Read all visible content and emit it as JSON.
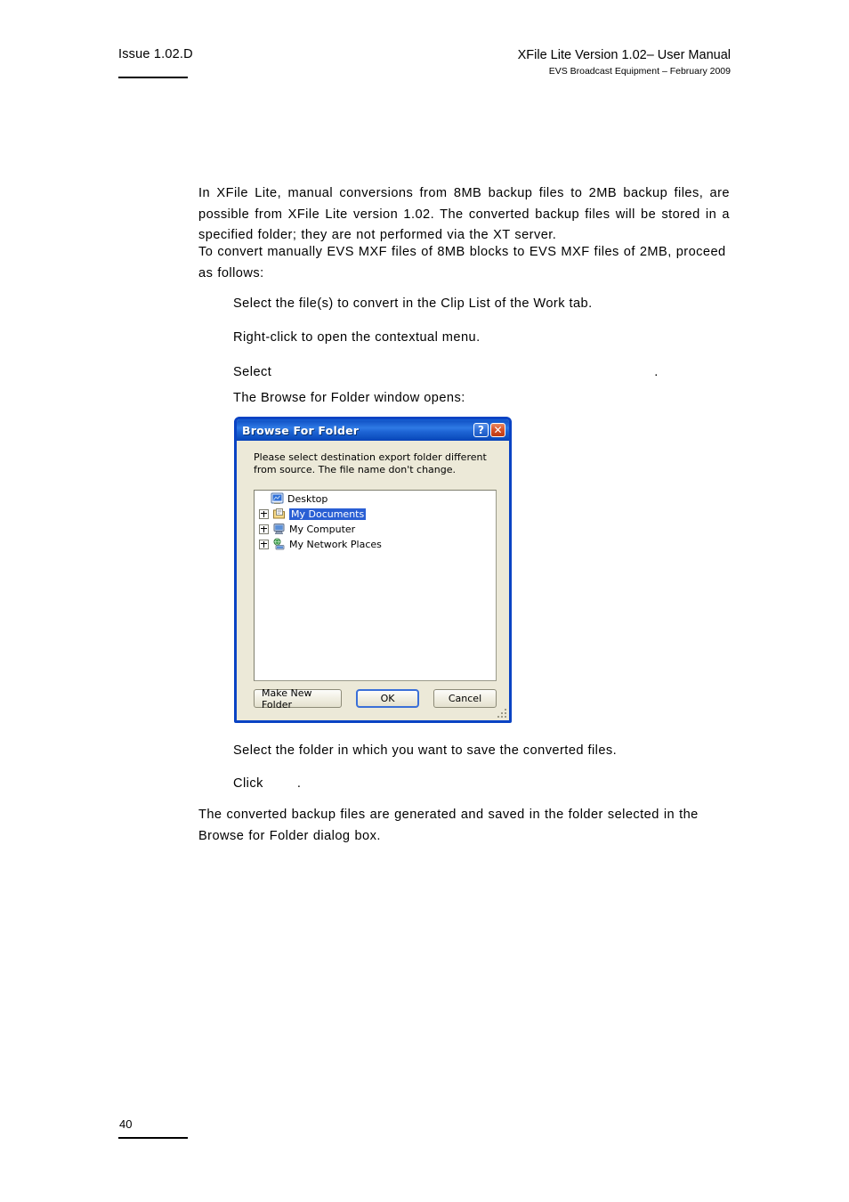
{
  "header": {
    "issue": "Issue 1.02.D",
    "manual_title": "XFile Lite Version 1.02– User Manual",
    "manual_subtitle": "EVS Broadcast Equipment – February 2009"
  },
  "content": {
    "paragraph_1": "In XFile Lite, manual conversions from 8MB backup files to 2MB backup files, are possible from XFile Lite version 1.02. The converted backup files will be stored in a specified folder; they are not performed via the XT server.",
    "paragraph_2": "To convert manually EVS MXF files of 8MB blocks to EVS MXF files of 2MB, proceed as follows:",
    "step_1": "Select the file(s) to convert in the Clip List of the Work tab.",
    "step_2": "Right-click to open the contextual menu.",
    "step_3_prefix": "Select",
    "step_3_suffix": ".",
    "step_4": "The Browse for Folder window opens:",
    "step_5": "Select the folder in which you want to save the converted files.",
    "step_6_prefix": "Click",
    "step_6_suffix": ".",
    "paragraph_3": "The converted backup files are generated and saved in the folder selected in the Browse for Folder dialog box."
  },
  "dialog": {
    "title": "Browse For Folder",
    "help_button": "?",
    "close_button": "✕",
    "instruction": "Please select destination export folder different from source. The file name don't change.",
    "tree": [
      {
        "label": "Desktop",
        "icon": "desktop-icon",
        "level": 0,
        "expandable": false,
        "selected": false
      },
      {
        "label": "My Documents",
        "icon": "my-documents-icon",
        "level": 1,
        "expandable": true,
        "selected": true
      },
      {
        "label": "My Computer",
        "icon": "my-computer-icon",
        "level": 1,
        "expandable": true,
        "selected": false
      },
      {
        "label": "My Network Places",
        "icon": "my-network-places-icon",
        "level": 1,
        "expandable": true,
        "selected": false
      }
    ],
    "buttons": {
      "make_new_folder": "Make New Folder",
      "ok": "OK",
      "cancel": "Cancel"
    },
    "colors": {
      "titlebar_blue": "#1a62d6",
      "window_face": "#ece9d8",
      "selection_blue": "#2a5fd4",
      "close_red": "#d9542a",
      "default_button_outline": "#3a6fd8"
    }
  },
  "footer": {
    "page_number": "40"
  }
}
